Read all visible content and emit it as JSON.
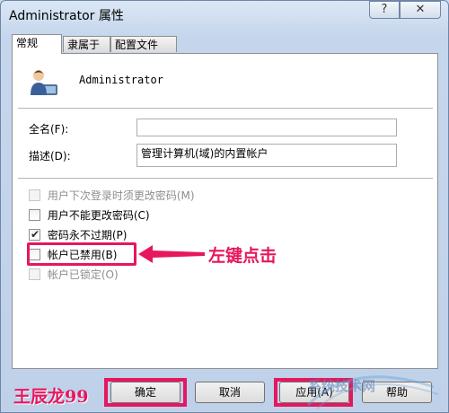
{
  "window": {
    "title": "Administrator 属性",
    "help_glyph": "?",
    "close_glyph": "✕"
  },
  "tabs": [
    {
      "label": "常规",
      "active": true
    },
    {
      "label": "隶属于",
      "active": false
    },
    {
      "label": "配置文件",
      "active": false
    }
  ],
  "general": {
    "user_icon": "user-account-icon",
    "username": "Administrator",
    "fullname_label": "全名(F):",
    "fullname_value": "",
    "description_label": "描述(D):",
    "description_value": "管理计算机(域)的内置帐户",
    "checkboxes": [
      {
        "label": "用户下次登录时须更改密码(M)",
        "checked": false,
        "enabled": false
      },
      {
        "label": "用户不能更改密码(C)",
        "checked": false,
        "enabled": true
      },
      {
        "label": "密码永不过期(P)",
        "checked": true,
        "enabled": true
      },
      {
        "label": "帐户已禁用(B)",
        "checked": false,
        "enabled": true
      },
      {
        "label": "帐户已锁定(O)",
        "checked": false,
        "enabled": false
      }
    ]
  },
  "annotation": {
    "text": "左键点击",
    "color": "#e6175f"
  },
  "buttons": {
    "ok": "确定",
    "cancel": "取消",
    "apply": "应用(A)",
    "help": "帮助"
  },
  "watermarks": {
    "left": "王辰龙99",
    "right": "系统技术网"
  }
}
